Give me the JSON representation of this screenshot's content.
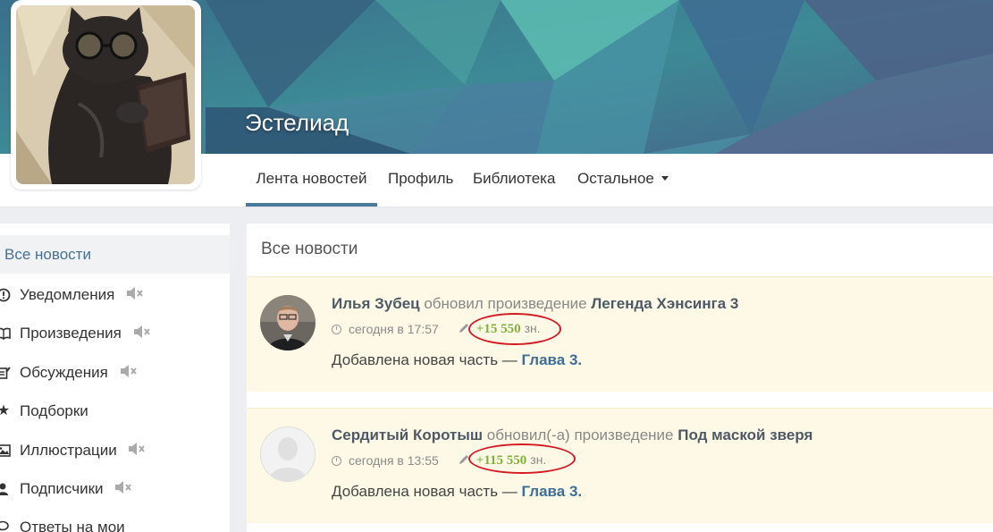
{
  "profile": {
    "name": "Эстелиад"
  },
  "nav": {
    "items": [
      {
        "label": "Лента новостей",
        "active": true
      },
      {
        "label": "Профиль"
      },
      {
        "label": "Библиотека"
      },
      {
        "label": "Остальное"
      }
    ]
  },
  "sidebar": {
    "items": [
      {
        "label": "Все новости",
        "icon": "none",
        "active": true
      },
      {
        "label": "Уведомления",
        "icon": "exclamation-circle-icon",
        "muted": true
      },
      {
        "label": "Произведения",
        "icon": "book-icon",
        "muted": true
      },
      {
        "label": "Обсуждения",
        "icon": "edit-icon",
        "muted": true
      },
      {
        "label": "Подборки",
        "icon": "star-icon"
      },
      {
        "label": "Иллюстрации",
        "icon": "image-icon",
        "muted": true
      },
      {
        "label": "Подписчики",
        "icon": "user-icon",
        "muted": true
      },
      {
        "label": "Ответы на мои",
        "icon": "comments-icon"
      }
    ]
  },
  "feed": {
    "title": "Все новости",
    "items": [
      {
        "author": "Илья Зубец",
        "action": " обновил произведение ",
        "work": "Легенда Хэнсинга 3",
        "time": "сегодня в 17:57",
        "chars": "+15 550",
        "chars_unit": "зн.",
        "body_prefix": "Добавлена новая часть — ",
        "chapter": "Глава 3."
      },
      {
        "author": "Сердитый Коротыш",
        "action": " обновил(-а) произведение ",
        "work": "Под маской зверя",
        "time": "сегодня в 13:55",
        "chars": "+115 550",
        "chars_unit": "зн.",
        "body_prefix": "Добавлена новая часть — ",
        "chapter": "Глава 3."
      }
    ]
  },
  "colors": {
    "accent": "#4a7a9a",
    "link": "#3d6e96",
    "chars_green": "#7fb23f",
    "highlight_red": "#d31c22",
    "card_bg": "#fdf9e6"
  }
}
